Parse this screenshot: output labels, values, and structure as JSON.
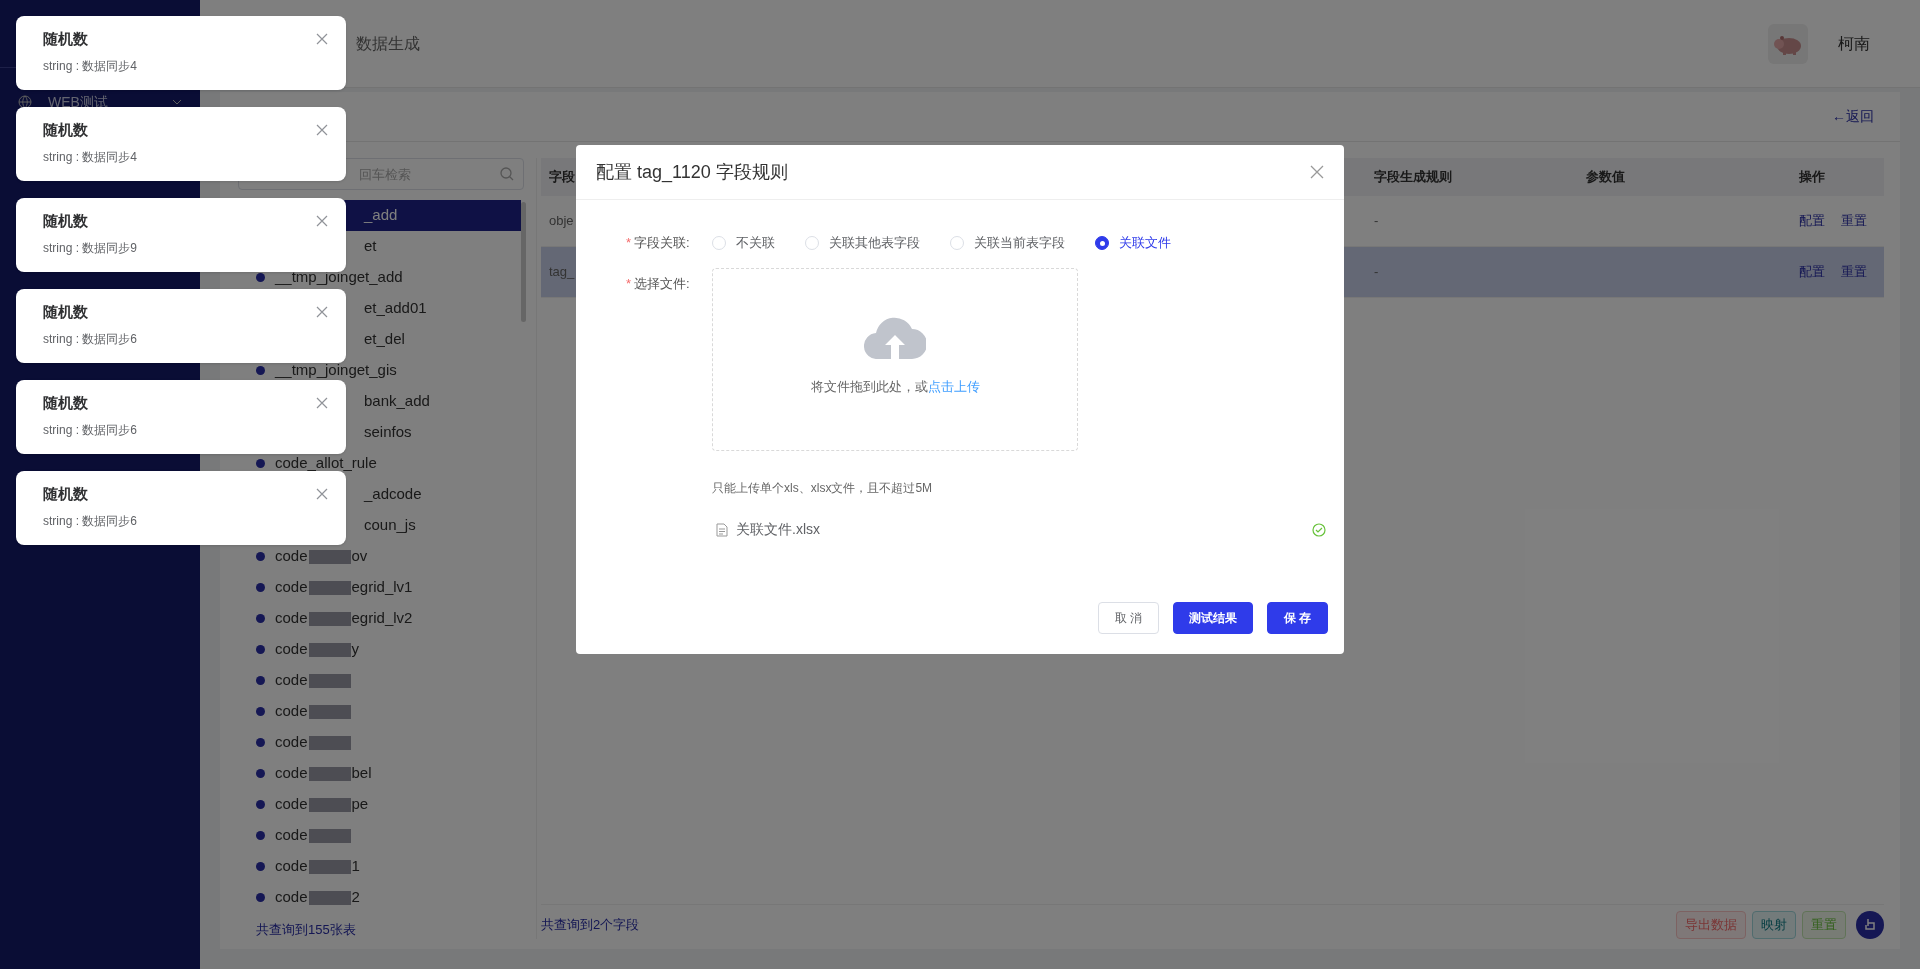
{
  "sidebar": {
    "menu": [
      {
        "label": "WEB测试"
      }
    ]
  },
  "header": {
    "breadcrumb": "数据生成",
    "user": "柯南"
  },
  "card": {
    "back_link": "←返回"
  },
  "tables_panel": {
    "search_placeholder": "回车检索",
    "items": [
      {
        "text": "_add",
        "kind": "partial",
        "selected": true
      },
      {
        "text": "et",
        "kind": "partial",
        "selected": false
      },
      {
        "text": "__tmp_joinget_add",
        "kind": "plain",
        "selected": false
      },
      {
        "text": "et_add01",
        "kind": "partial",
        "selected": false
      },
      {
        "text": "et_del",
        "kind": "partial",
        "selected": false
      },
      {
        "text": "__tmp_joinget_gis",
        "kind": "plain",
        "selected": false
      },
      {
        "text": "bank_add",
        "kind": "partial",
        "selected": false
      },
      {
        "text": "seinfos",
        "kind": "partial",
        "selected": false
      },
      {
        "text": "code_allot_rule",
        "kind": "plain",
        "selected": false
      },
      {
        "text": "_adcode",
        "kind": "partial",
        "selected": false
      },
      {
        "text": "coun_js",
        "kind": "partial",
        "selected": false
      },
      {
        "text": "code",
        "tail": "ov",
        "kind": "blurred",
        "selected": false
      },
      {
        "text": "code",
        "tail": "egrid_lv1",
        "kind": "blurred",
        "selected": false
      },
      {
        "text": "code",
        "tail": "egrid_lv2",
        "kind": "blurred",
        "selected": false
      },
      {
        "text": "code",
        "tail": "y",
        "kind": "blurred",
        "selected": false
      },
      {
        "text": "code",
        "kind": "blurred",
        "selected": false
      },
      {
        "text": "code",
        "kind": "blurred",
        "selected": false
      },
      {
        "text": "code",
        "kind": "blurred",
        "selected": false
      },
      {
        "text": "code",
        "tail": "bel",
        "kind": "blurred",
        "selected": false
      },
      {
        "text": "code",
        "tail": "pe",
        "kind": "blurred",
        "selected": false
      },
      {
        "text": "code",
        "kind": "blurred",
        "selected": false
      },
      {
        "text": "code",
        "tail": "1",
        "kind": "blurred",
        "selected": false
      },
      {
        "text": "code",
        "tail": "2",
        "kind": "blurred",
        "selected": false
      }
    ],
    "footer": "共查询到155张表"
  },
  "fields_table": {
    "columns": [
      "字段",
      "字段生成规则",
      "参数值",
      "操作"
    ],
    "rows": [
      {
        "cells": [
          "obje",
          "-"
        ],
        "actions": [
          "配置",
          "重置"
        ],
        "selected": false
      },
      {
        "cells": [
          "tag_",
          "-"
        ],
        "actions": [
          "配置",
          "重置"
        ],
        "selected": true
      }
    ],
    "footer": "共查询到2个字段",
    "toolbar": [
      {
        "label": "导出数据",
        "kind": "danger"
      },
      {
        "label": "映射",
        "kind": "info"
      },
      {
        "label": "重置",
        "kind": "success"
      }
    ]
  },
  "notifications": [
    {
      "title": "随机数",
      "message": "string : 数据同步4"
    },
    {
      "title": "随机数",
      "message": "string : 数据同步4"
    },
    {
      "title": "随机数",
      "message": "string : 数据同步9"
    },
    {
      "title": "随机数",
      "message": "string : 数据同步6"
    },
    {
      "title": "随机数",
      "message": "string : 数据同步6"
    },
    {
      "title": "随机数",
      "message": "string : 数据同步6"
    }
  ],
  "dialog": {
    "title": "配置 tag_1120 字段规则",
    "relation_label": {
      "mark": "*",
      "text": "字段关联:"
    },
    "options": [
      {
        "label": "不关联",
        "selected": false
      },
      {
        "label": "关联其他表字段",
        "selected": false
      },
      {
        "label": "关联当前表字段",
        "selected": false
      },
      {
        "label": "关联文件",
        "selected": true
      }
    ],
    "file_label": {
      "mark": "*",
      "text": "选择文件:"
    },
    "upload_text": "将文件拖到此处，或",
    "upload_link": "点击上传",
    "hint": "只能上传单个xls、xlsx文件，且不超过5M",
    "file": {
      "name": "关联文件.xlsx",
      "uploaded": true
    },
    "buttons": [
      {
        "label": "取 消",
        "kind": "plain"
      },
      {
        "label": "测试结果",
        "kind": "primary"
      },
      {
        "label": "保 存",
        "kind": "primary"
      }
    ]
  }
}
